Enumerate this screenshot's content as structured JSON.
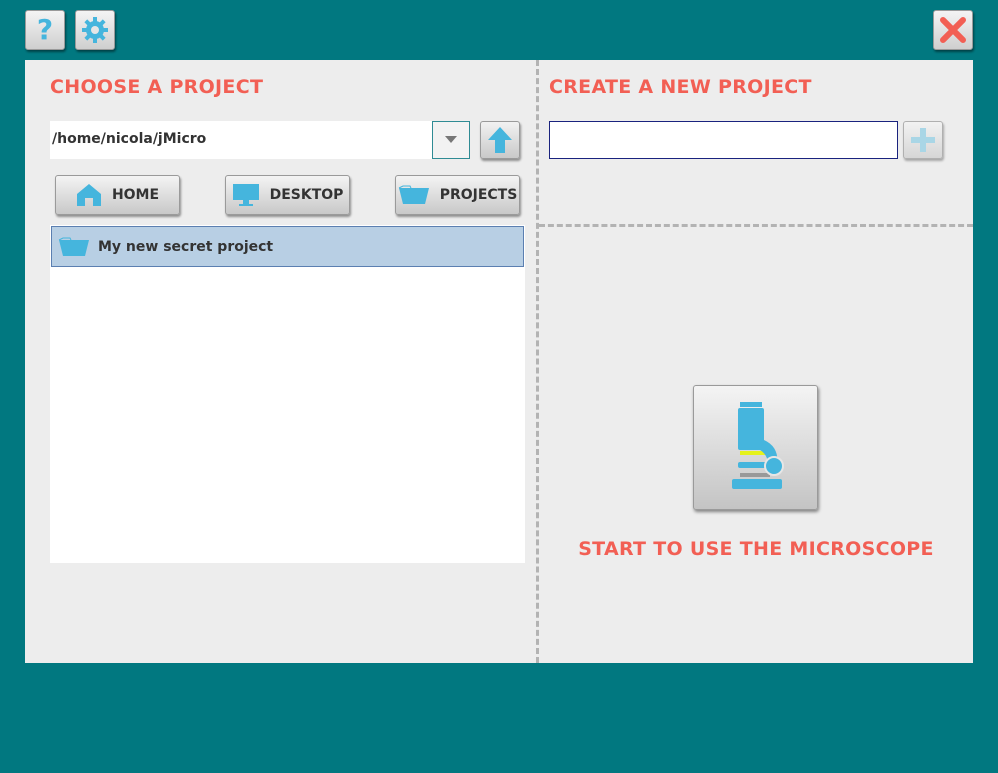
{
  "toolbar": {
    "help_icon": "question-mark-icon",
    "settings_icon": "gear-icon",
    "close_icon": "close-icon"
  },
  "choose": {
    "title": "CHOOSE A PROJECT",
    "path": "/home/nicola/jMicro",
    "buttons": {
      "home": "HOME",
      "desktop": "DESKTOP",
      "projects": "PROJECTS"
    },
    "items": [
      {
        "label": "My new secret project",
        "selected": true
      }
    ]
  },
  "create": {
    "title": "CREATE A NEW PROJECT",
    "input_value": ""
  },
  "start": {
    "label": "START TO USE THE MICROSCOPE",
    "icon": "microscope-icon"
  },
  "colors": {
    "background": "#017880",
    "accent": "#f25f54",
    "icon": "#45b5dd",
    "selection": "#b8cfe4"
  }
}
